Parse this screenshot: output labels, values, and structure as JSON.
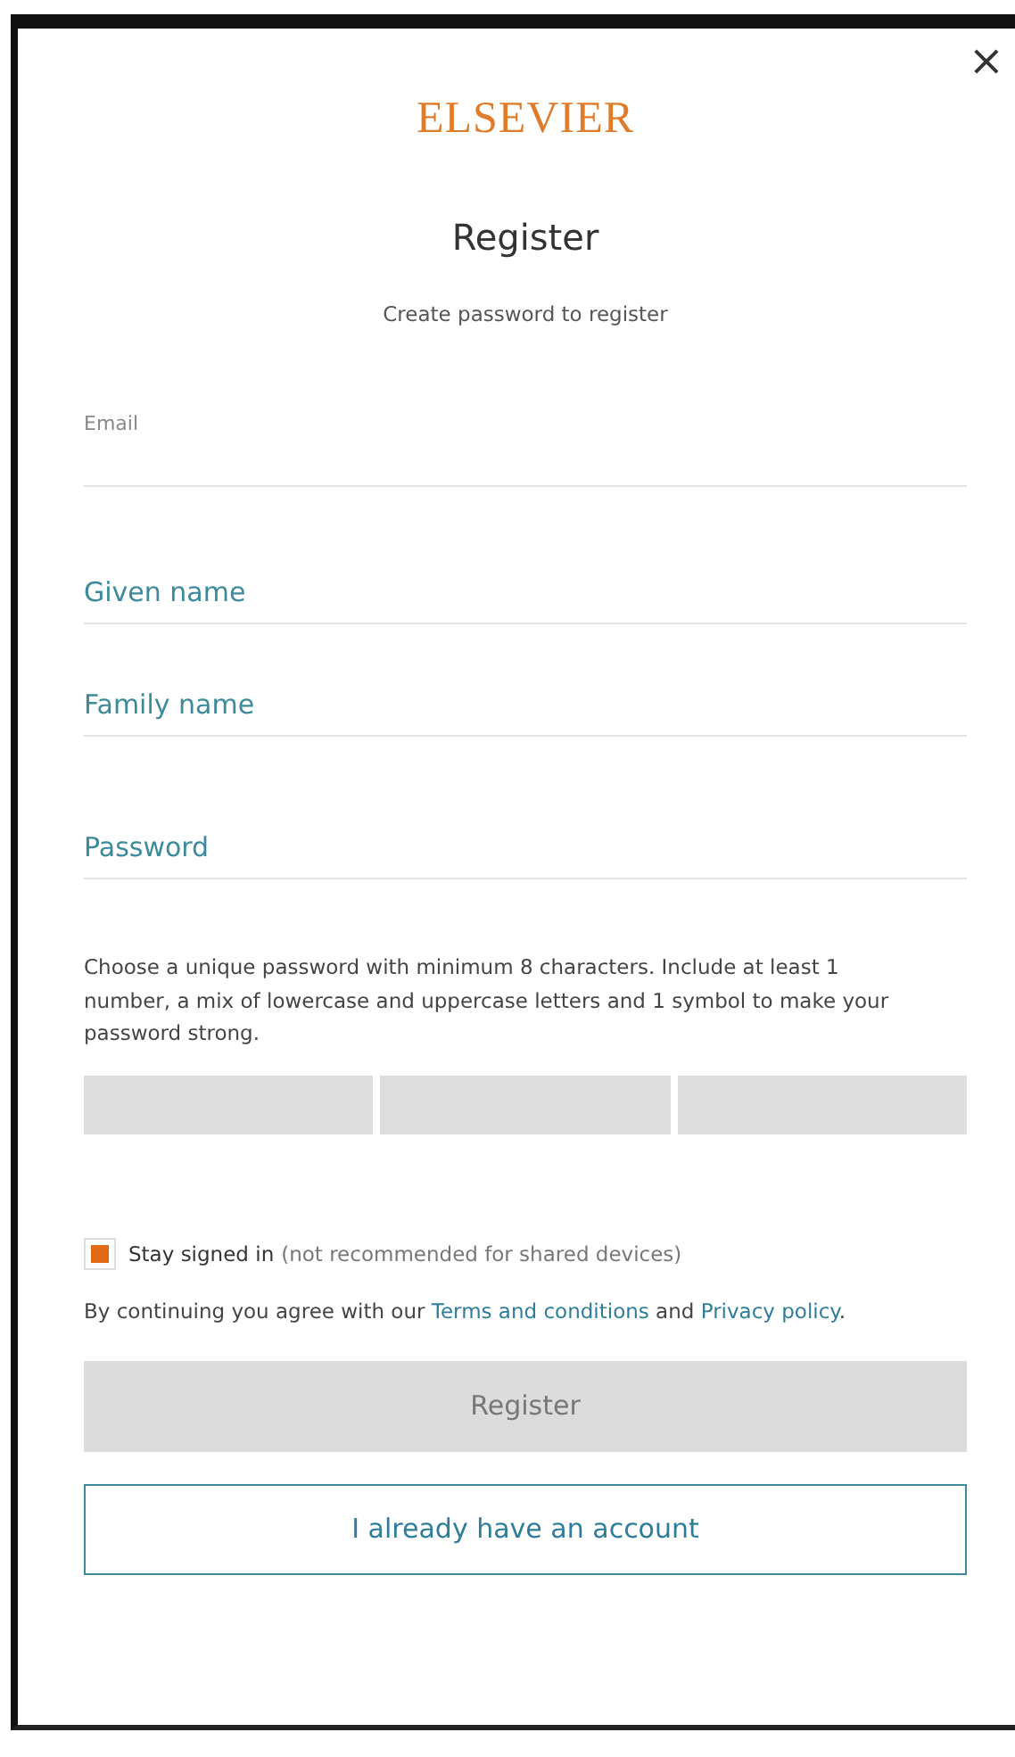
{
  "dialog": {
    "close": "×",
    "logo": "ELSEVIER",
    "title": "Register",
    "subtitle": "Create password to register"
  },
  "fields": [
    {
      "kind": "labelled",
      "label": "Email"
    },
    {
      "kind": "plain",
      "placeholder": "Given name"
    },
    {
      "kind": "plain",
      "placeholder": "Family name"
    },
    {
      "kind": "plain",
      "placeholder": "Password"
    }
  ],
  "password_hint": "Choose a unique password with minimum 8 characters. Include at least 1 number, a mix of lowercase and uppercase letters and 1 symbol to make your password strong.",
  "stay_signed_in": {
    "checked": true,
    "label": "Stay signed in",
    "note": "(not recommended for shared devices)"
  },
  "terms": {
    "before": "By continuing you agree with our",
    "link1": "Terms and conditions",
    "middle": "and",
    "link2": "Privacy policy",
    "after": "."
  },
  "register_button": {
    "label": "Register",
    "disabled": true
  },
  "account_button": {
    "label": "I already have an account"
  }
}
